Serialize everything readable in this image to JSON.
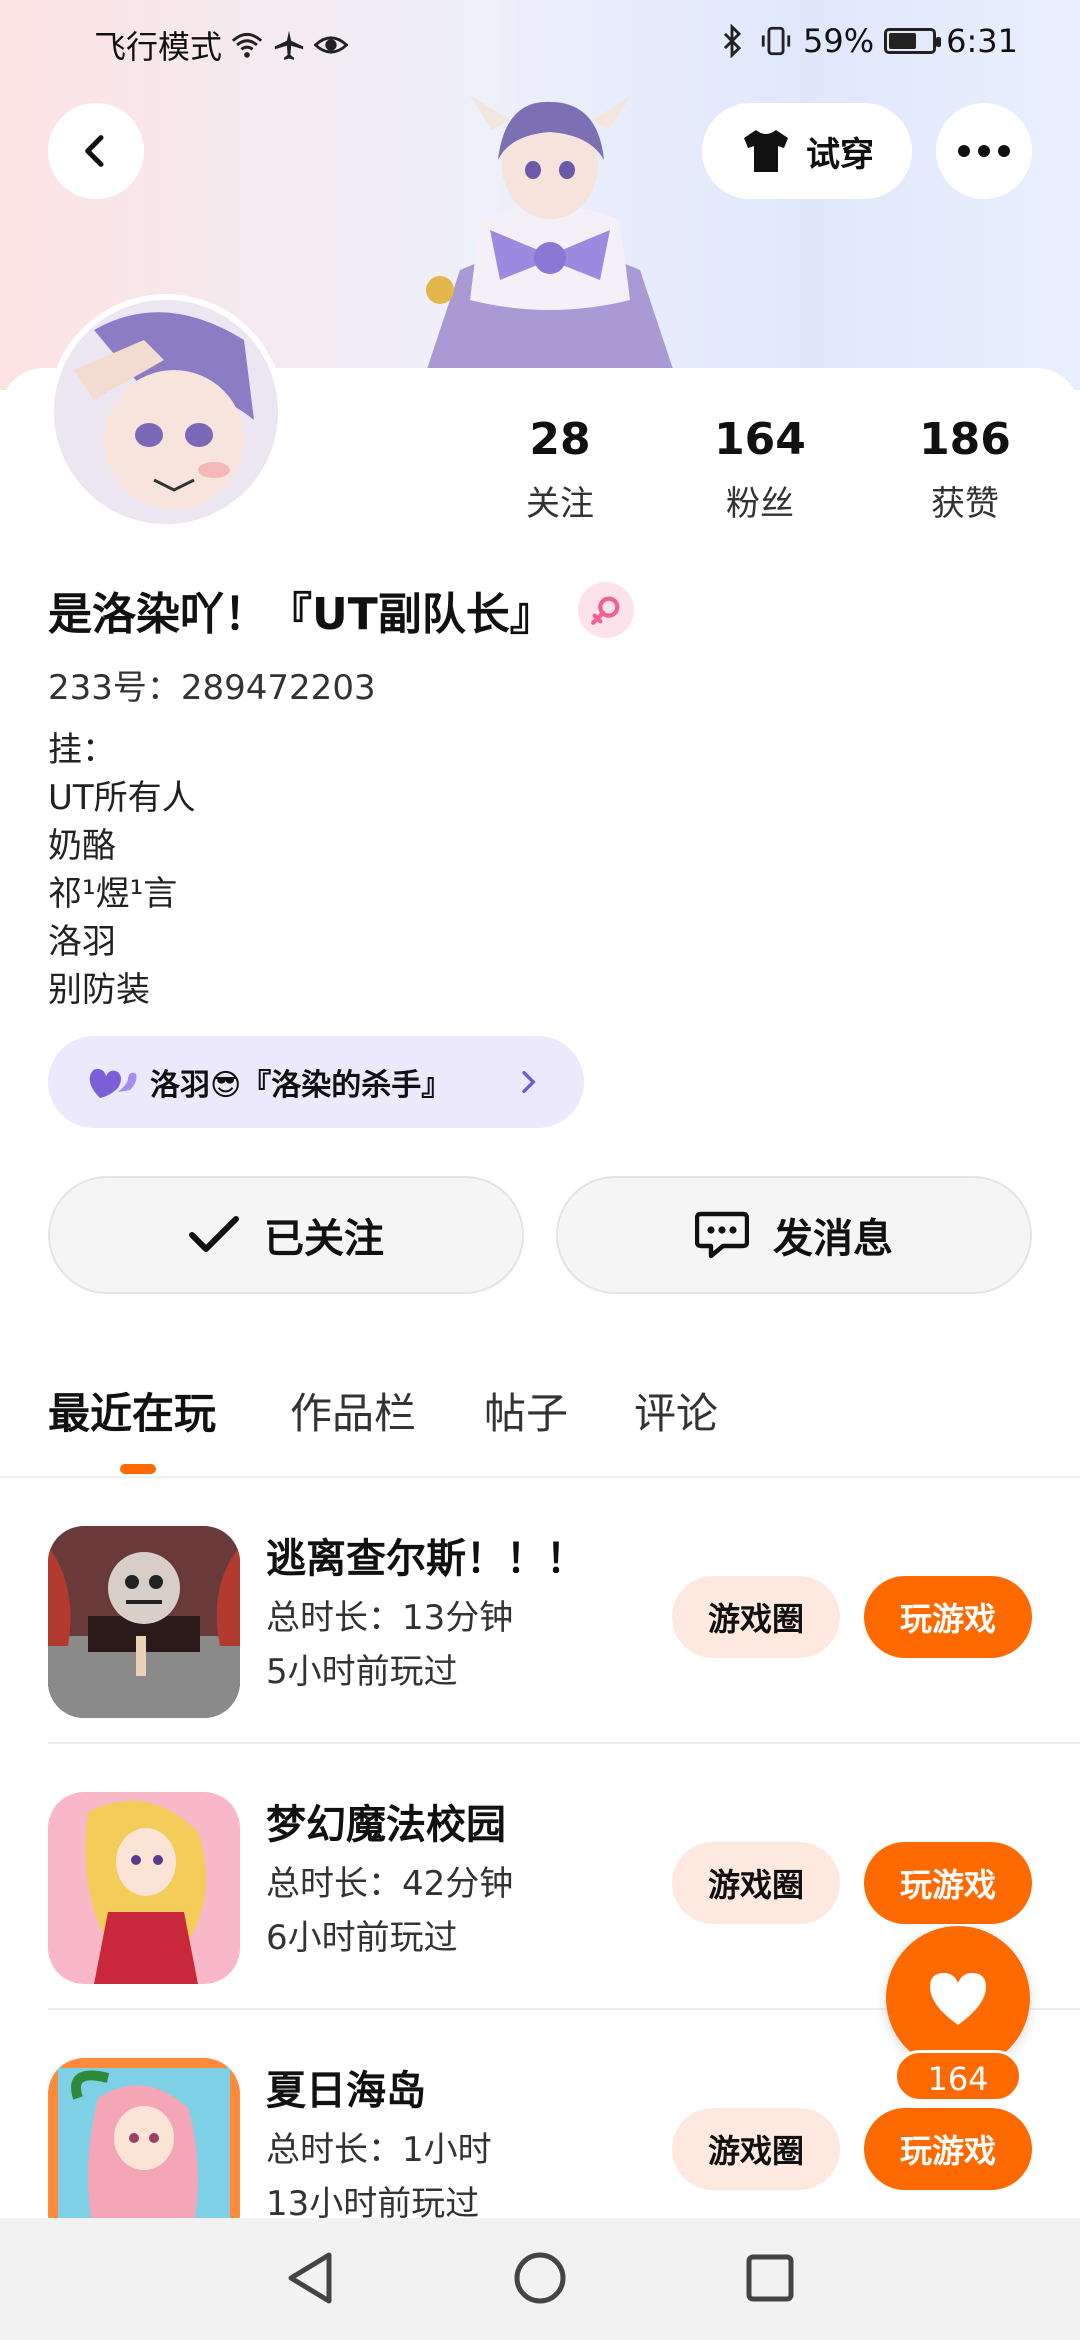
{
  "status_bar": {
    "left_text": "飞行模式",
    "battery": "59%",
    "time": "6:31"
  },
  "header": {
    "tryon_label": "试穿"
  },
  "profile": {
    "stats": [
      {
        "value": "28",
        "label": "关注"
      },
      {
        "value": "164",
        "label": "粉丝"
      },
      {
        "value": "186",
        "label": "获赞"
      }
    ],
    "nickname": "是洛染吖！『UT副队长』",
    "uid": "233号：289472203",
    "bio_lines": [
      "挂：",
      "UT所有人",
      "奶酪",
      "祁¹煜¹言",
      "洛羽",
      "别防装"
    ],
    "guild_chip": "洛羽😎『洛染的杀手』"
  },
  "actions": {
    "follow_label": "已关注",
    "message_label": "发消息"
  },
  "tabs": [
    "最近在玩",
    "作品栏",
    "帖子",
    "评论"
  ],
  "games": [
    {
      "title": "逃离查尔斯！！！",
      "duration": "总时长：13分钟",
      "last_played": "5小时前玩过",
      "circle_label": "游戏圈",
      "play_label": "玩游戏"
    },
    {
      "title": "梦幻魔法校园",
      "duration": "总时长：42分钟",
      "last_played": "6小时前玩过",
      "circle_label": "游戏圈",
      "play_label": "玩游戏"
    },
    {
      "title": "夏日海岛",
      "duration": "总时长：1小时",
      "last_played": "13小时前玩过",
      "circle_label": "游戏圈",
      "play_label": "玩游戏"
    }
  ],
  "like_fab": {
    "count": "164"
  },
  "colors": {
    "accent": "#ff6a00",
    "chip_bg": "#ebe9fb",
    "circle_btn_bg": "#fde9df"
  }
}
